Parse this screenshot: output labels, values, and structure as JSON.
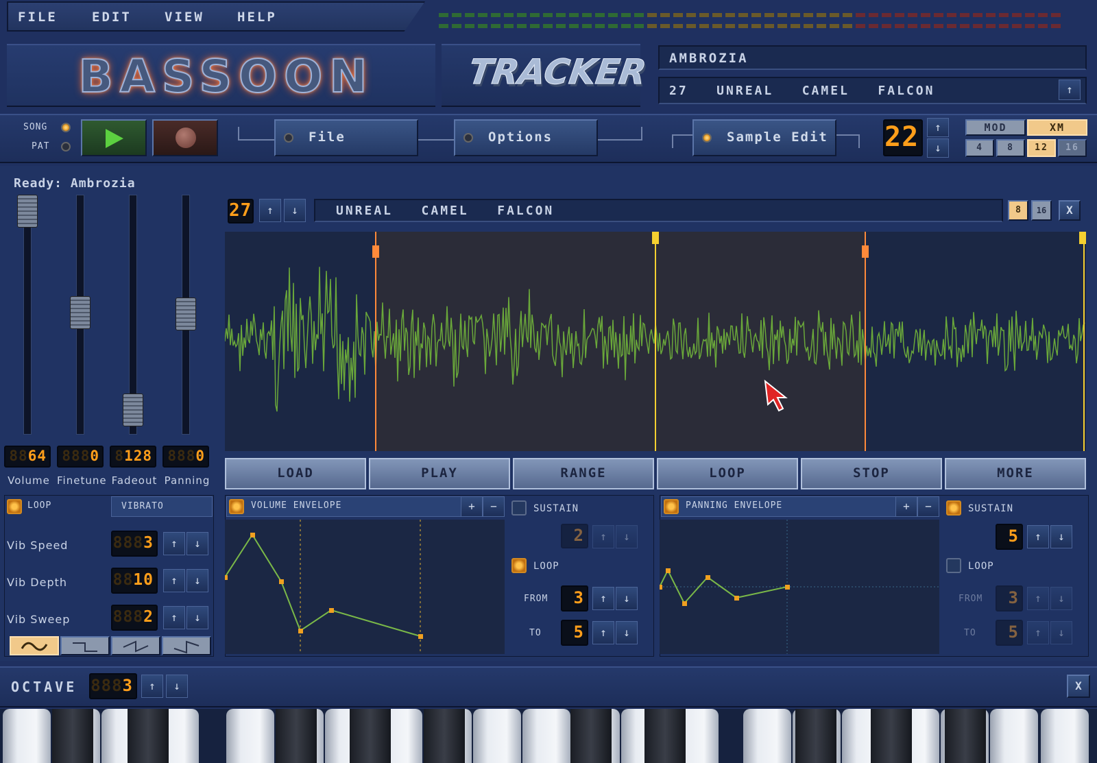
{
  "menu": [
    "FILE",
    "EDIT",
    "VIEW",
    "HELP"
  ],
  "logo": {
    "left": "BASSOON",
    "right": "TRACKER"
  },
  "song": {
    "title": "AMBROZIA",
    "pattern_line": "27   UNREAL   CAMEL   FALCON"
  },
  "transport": {
    "song_label": "SONG",
    "pat_label": "PAT"
  },
  "toolbar": {
    "file": "File",
    "options": "Options",
    "sample_edit": "Sample Edit"
  },
  "tempo": {
    "value": "22",
    "ghost": "88"
  },
  "format": {
    "mod": "MOD",
    "xm": "XM",
    "channels": [
      "4",
      "8",
      "12",
      "16"
    ]
  },
  "status": "Ready: Ambrozia",
  "sample": {
    "number": "27",
    "name": "UNREAL   CAMEL   FALCON",
    "view_8": "8",
    "view_16": "16",
    "close": "X"
  },
  "sliders": [
    {
      "label": "Volume",
      "value": "64",
      "ghost": "88"
    },
    {
      "label": "Finetune",
      "value": "0",
      "ghost": "888"
    },
    {
      "label": "Fadeout",
      "value": "128",
      "ghost": "8"
    },
    {
      "label": "Panning",
      "value": "0",
      "ghost": "888"
    }
  ],
  "sample_buttons": [
    "LOAD",
    "PLAY",
    "RANGE",
    "LOOP",
    "STOP",
    "MORE"
  ],
  "tabs": {
    "loop": "LOOP",
    "vibrato": "VIBRATO"
  },
  "vibrato": [
    {
      "label": "Vib Speed",
      "value": "3",
      "ghost": "888"
    },
    {
      "label": "Vib Depth",
      "value": "10",
      "ghost": "88"
    },
    {
      "label": "Vib Sweep",
      "value": "2",
      "ghost": "888"
    }
  ],
  "volume_envelope": {
    "title": "VOLUME ENVELOPE",
    "sustain": "SUSTAIN",
    "sustain_value": "2",
    "sustain_ghost": "8",
    "loop": "LOOP",
    "from_label": "FROM",
    "from_value": "3",
    "from_ghost": "8",
    "to_label": "TO",
    "to_value": "5",
    "to_ghost": "8",
    "plus": "+",
    "minus": "−"
  },
  "panning_envelope": {
    "title": "PANNING ENVELOPE",
    "sustain": "SUSTAIN",
    "sustain_value": "5",
    "sustain_ghost": "8",
    "loop": "LOOP",
    "from_label": "FROM",
    "from_value": "3",
    "from_ghost": "8",
    "to_label": "TO",
    "to_value": "5",
    "to_ghost": "8",
    "plus": "+",
    "minus": "−"
  },
  "octave": {
    "label": "OCTAVE",
    "value": "3",
    "ghost": "888",
    "close": "X"
  },
  "arrows": {
    "up": "↑",
    "down": "↓"
  },
  "colors": {
    "lcd": "#ff9e1a",
    "wave": "#6aa83a",
    "loop_marker": "#ff8a3a",
    "cursor_marker": "#f5d030"
  }
}
